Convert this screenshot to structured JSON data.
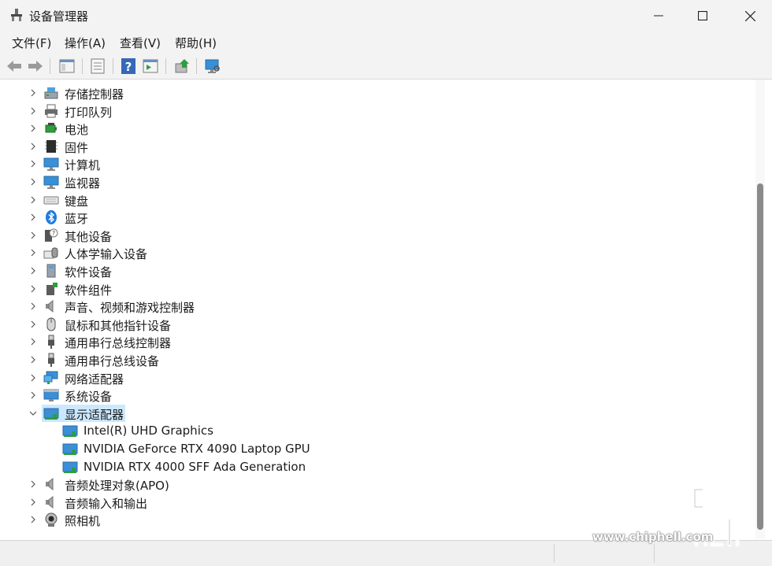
{
  "window": {
    "title": "设备管理器"
  },
  "menu": [
    "文件(F)",
    "操作(A)",
    "查看(V)",
    "帮助(H)"
  ],
  "toolbar_icons": [
    "back-arrow-icon",
    "forward-arrow-icon",
    "show-hide-tree-icon",
    "properties-icon",
    "help-icon",
    "action-pane-icon",
    "update-driver-icon",
    "scan-hardware-icon"
  ],
  "tree": {
    "items": [
      {
        "label": "存储控制器",
        "icon": "storage-controller-icon",
        "expanded": false
      },
      {
        "label": "打印队列",
        "icon": "printer-icon",
        "expanded": false
      },
      {
        "label": "电池",
        "icon": "battery-icon",
        "expanded": false
      },
      {
        "label": "固件",
        "icon": "firmware-icon",
        "expanded": false
      },
      {
        "label": "计算机",
        "icon": "computer-icon",
        "expanded": false
      },
      {
        "label": "监视器",
        "icon": "monitor-icon",
        "expanded": false
      },
      {
        "label": "键盘",
        "icon": "keyboard-icon",
        "expanded": false
      },
      {
        "label": "蓝牙",
        "icon": "bluetooth-icon",
        "expanded": false
      },
      {
        "label": "其他设备",
        "icon": "other-devices-icon",
        "expanded": false
      },
      {
        "label": "人体学输入设备",
        "icon": "hid-icon",
        "expanded": false
      },
      {
        "label": "软件设备",
        "icon": "software-device-icon",
        "expanded": false
      },
      {
        "label": "软件组件",
        "icon": "software-component-icon",
        "expanded": false
      },
      {
        "label": "声音、视频和游戏控制器",
        "icon": "speaker-icon",
        "expanded": false
      },
      {
        "label": "鼠标和其他指针设备",
        "icon": "mouse-icon",
        "expanded": false
      },
      {
        "label": "通用串行总线控制器",
        "icon": "usb-icon",
        "expanded": false
      },
      {
        "label": "通用串行总线设备",
        "icon": "usb-icon",
        "expanded": false
      },
      {
        "label": "网络适配器",
        "icon": "network-adapter-icon",
        "expanded": false
      },
      {
        "label": "系统设备",
        "icon": "system-device-icon",
        "expanded": false
      },
      {
        "label": "显示适配器",
        "icon": "display-adapter-icon",
        "expanded": true,
        "selected": true,
        "children": [
          {
            "label": "Intel(R) UHD Graphics",
            "icon": "display-adapter-icon"
          },
          {
            "label": "NVIDIA GeForce RTX 4090 Laptop GPU",
            "icon": "display-adapter-icon"
          },
          {
            "label": "NVIDIA RTX 4000 SFF Ada Generation",
            "icon": "display-adapter-icon"
          }
        ]
      },
      {
        "label": "音频处理对象(APO)",
        "icon": "speaker-icon",
        "expanded": false
      },
      {
        "label": "音频输入和输出",
        "icon": "speaker-icon",
        "expanded": false
      },
      {
        "label": "照相机",
        "icon": "camera-icon",
        "expanded": false
      }
    ]
  },
  "watermark": {
    "site": "www.chiphell.com",
    "logo": "chip hell"
  },
  "colors": {
    "selection": "#cce8ff",
    "chrome": "#f3f3f3",
    "accent": "#0078d4"
  }
}
